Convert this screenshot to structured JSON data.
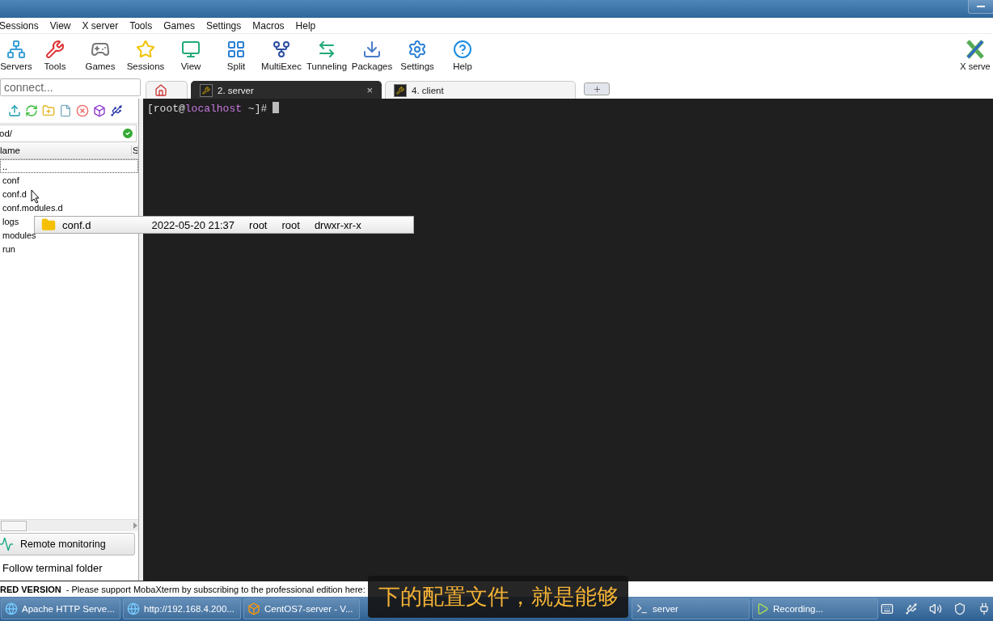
{
  "menu": [
    "Sessions",
    "View",
    "X server",
    "Tools",
    "Games",
    "Settings",
    "Macros",
    "Help"
  ],
  "toolbar": [
    {
      "label": "Servers"
    },
    {
      "label": "Tools"
    },
    {
      "label": "Games"
    },
    {
      "label": "Sessions"
    },
    {
      "label": "View"
    },
    {
      "label": "Split"
    },
    {
      "label": "MultiExec"
    },
    {
      "label": "Tunneling"
    },
    {
      "label": "Packages"
    },
    {
      "label": "Settings"
    },
    {
      "label": "Help"
    }
  ],
  "toolbar_right": {
    "label": "X serve"
  },
  "quick_connect": {
    "placeholder": "connect..."
  },
  "tabs": [
    {
      "kind": "home",
      "selected": false
    },
    {
      "kind": "session",
      "label": "2. server",
      "selected": true,
      "close": "×"
    },
    {
      "kind": "session",
      "label": "4. client",
      "selected": false
    },
    {
      "kind": "new",
      "selected": false
    }
  ],
  "sftp": {
    "path": "od/",
    "columns": [
      "lame",
      "S"
    ],
    "files": [
      {
        "name": "..",
        "selected": true
      },
      {
        "name": "conf",
        "selected": false
      },
      {
        "name": "conf.d",
        "selected": false
      },
      {
        "name": "conf.modules.d",
        "selected": false
      },
      {
        "name": "logs",
        "selected": false
      },
      {
        "name": "modules",
        "selected": false
      },
      {
        "name": "run",
        "selected": false
      }
    ],
    "remote_monitoring": "Remote monitoring",
    "follow_folder": "Follow terminal folder"
  },
  "drag_tooltip": {
    "name": "conf.d",
    "date": "2022-05-20 21:37",
    "owner": "root",
    "group": "root",
    "permissions": "drwxr-xr-x"
  },
  "terminal": {
    "lines": [
      {
        "parts": [
          {
            "kind": "plain",
            "text": "[root@"
          },
          {
            "kind": "host",
            "text": "localhost"
          },
          {
            "kind": "plain",
            "text": " ~]#"
          }
        ],
        "cursor": true
      }
    ]
  },
  "status_bar": {
    "edition": "RED VERSION",
    "message": "- Please support MobaXterm by subscribing to the professional edition here:"
  },
  "subtitle": "下的配置文件，就是能够",
  "taskbar": [
    {
      "label": "Apache HTTP Serve..."
    },
    {
      "label": "http://192.168.4.200..."
    },
    {
      "label": "CentOS7-server - V..."
    },
    {
      "label": "server"
    },
    {
      "label": "Recording..."
    }
  ]
}
